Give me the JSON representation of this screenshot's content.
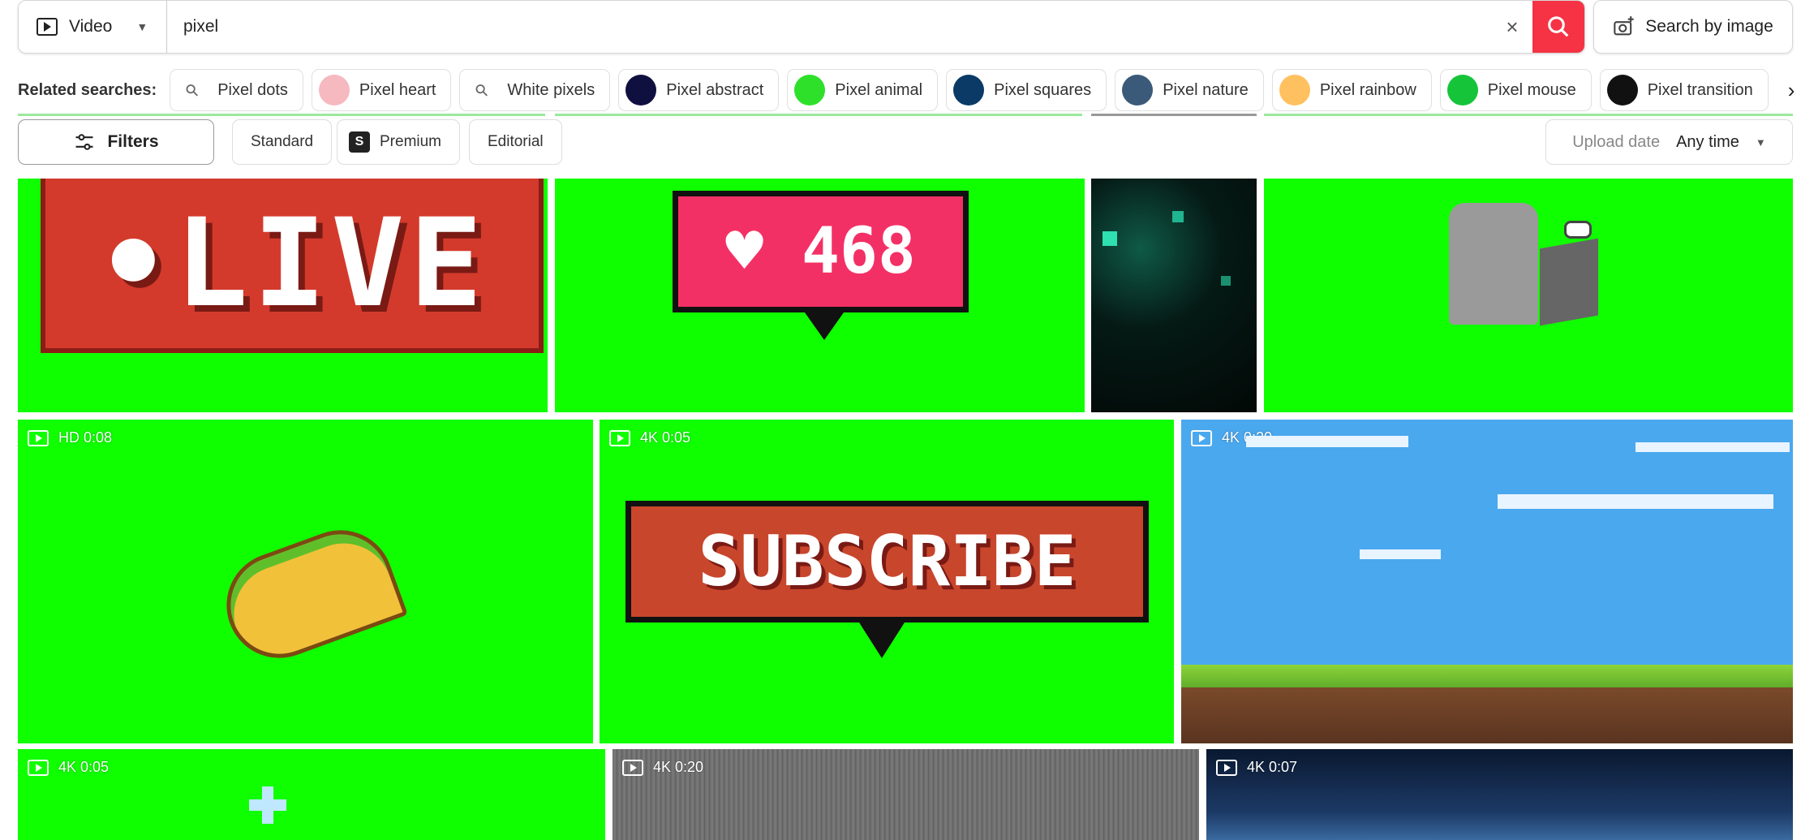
{
  "search": {
    "type": "Video",
    "query": "pixel",
    "search_by_image": "Search by image",
    "accent": "#f53345"
  },
  "related": {
    "label": "Related searches:",
    "items": [
      {
        "label": "Pixel dots",
        "thumb": "search-icon"
      },
      {
        "label": "Pixel heart",
        "thumb": "#f6b9c0"
      },
      {
        "label": "White pixels",
        "thumb": "search-icon"
      },
      {
        "label": "Pixel abstract",
        "thumb": "#101040"
      },
      {
        "label": "Pixel animal",
        "thumb": "#2ee02a"
      },
      {
        "label": "Pixel squares",
        "thumb": "#0b3a66"
      },
      {
        "label": "Pixel nature",
        "thumb": "#3b5a7a"
      },
      {
        "label": "Pixel rainbow",
        "thumb": "#ffc060"
      },
      {
        "label": "Pixel mouse",
        "thumb": "#16c43a"
      },
      {
        "label": "Pixel transition",
        "thumb": "#111111"
      }
    ]
  },
  "filters": {
    "label": "Filters",
    "chips": [
      "Standard",
      "Premium",
      "Editorial"
    ],
    "premium_badge": "S",
    "upload_label": "Upload date",
    "upload_value": "Any time"
  },
  "results": {
    "row1": [
      {
        "text": "•LIVE"
      },
      {
        "text": "♥ 468"
      },
      {
        "text": ""
      },
      {
        "text": ""
      }
    ],
    "row2": [
      {
        "badge": "HD 0:08"
      },
      {
        "badge": "4K 0:05",
        "text": "SUBSCRIBE"
      },
      {
        "badge": "4K 0:20"
      }
    ],
    "row3": [
      {
        "badge": "4K 0:05"
      },
      {
        "badge": "4K 0:20"
      },
      {
        "badge": "4K 0:07"
      }
    ]
  }
}
